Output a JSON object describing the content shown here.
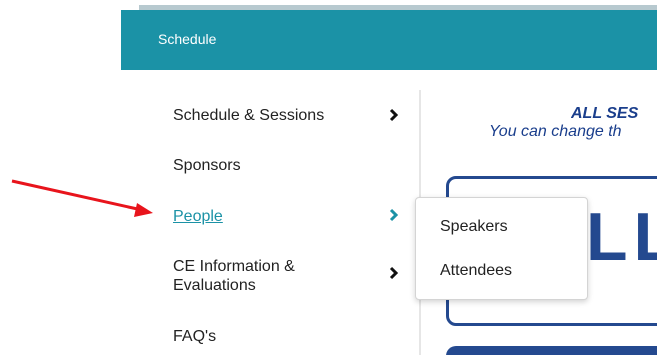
{
  "header": {
    "title": "Schedule"
  },
  "sidebar": {
    "items": [
      {
        "label": "Schedule & Sessions",
        "has_submenu": true
      },
      {
        "label": "Sponsors",
        "has_submenu": false
      },
      {
        "label": "People",
        "has_submenu": true,
        "active": true
      },
      {
        "label": "CE Information & Evaluations",
        "has_submenu": true
      },
      {
        "label": "FAQ's",
        "has_submenu": false
      }
    ]
  },
  "submenu": {
    "items": [
      {
        "label": "Speakers"
      },
      {
        "label": "Attendees"
      }
    ]
  },
  "content": {
    "banner_line1": "ALL SES",
    "banner_line2": "You can change th",
    "big_text": "LL"
  },
  "colors": {
    "header": "#1b92a6",
    "link_active": "#1b92a6",
    "annotation_arrow": "#e8141c",
    "content_blue": "#24498f"
  }
}
